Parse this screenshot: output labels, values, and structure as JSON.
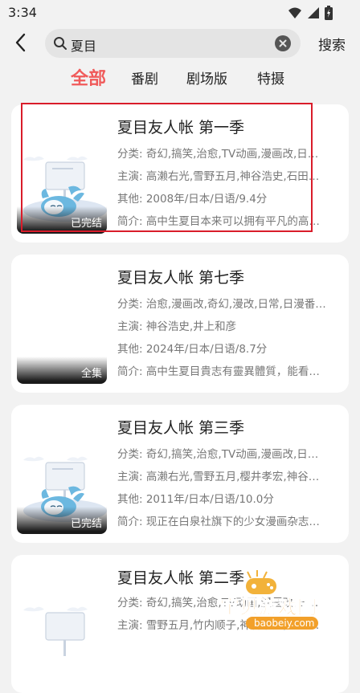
{
  "status": {
    "time": "3:34"
  },
  "search": {
    "query": "夏目",
    "button_label": "搜索"
  },
  "tabs": [
    {
      "label": "全部",
      "active": true
    },
    {
      "label": "番剧",
      "active": false
    },
    {
      "label": "剧场版",
      "active": false
    },
    {
      "label": "特摄",
      "active": false
    }
  ],
  "results": [
    {
      "title": "夏目友人帐 第一季",
      "category": "分类: 奇幻,搞笑,治愈,TV动画,漫画改,日…",
      "cast": "主演: 高濑右光,雪野五月,神谷浩史,石田…",
      "other": "其他: 2008年/日本/日语/9.4分",
      "intro": "简介: 高中生夏目本来可以拥有平凡的高…",
      "badge": "已完结",
      "poster_style": "illustration"
    },
    {
      "title": "夏目友人帐 第七季",
      "category": "分类: 治愈,漫画改,奇幻,漫改,日常,日漫番…",
      "cast": "主演: 神谷浩史,井上和彦",
      "other": "其他: 2024年/日本/日语/8.7分",
      "intro": "简介: 高中生夏目貴志有靈異體質，能看…",
      "badge": "全集",
      "poster_style": "blank"
    },
    {
      "title": "夏目友人帐 第三季",
      "category": "分类: 奇幻,搞笑,治愈,TV动画,漫画改,日…",
      "cast": "主演: 高濑右光,雪野五月,樱井孝宏,神谷…",
      "other": "其他: 2011年/日本/日语/10.0分",
      "intro": "简介: 现正在白泉社旗下的少女漫画杂志…",
      "badge": "已完结",
      "poster_style": "illustration"
    },
    {
      "title": "夏目友人帐 第二季",
      "category": "分类: 奇幻,搞笑,治愈,TV动画,漫画改,日…",
      "cast": "主演: 雪野五月,竹内顺子,神谷浩史,佐藤…",
      "other": "",
      "intro": "",
      "badge": "",
      "poster_style": "illustration"
    }
  ],
  "watermark": {
    "text": "宝贝游戏网",
    "url": "baobeiy.com"
  },
  "colors": {
    "accent": "#f05a5a",
    "highlight": "#d91c2a"
  }
}
